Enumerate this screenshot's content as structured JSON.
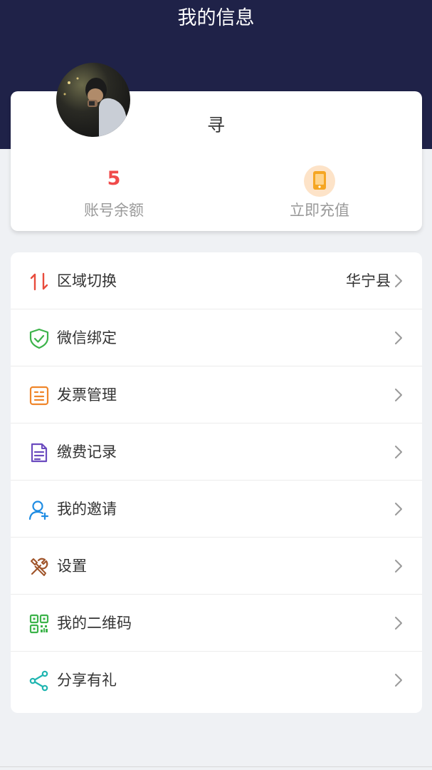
{
  "header": {
    "title": "我的信息"
  },
  "profile": {
    "username": "寻",
    "balance_value": "5",
    "balance_label": "账号余额",
    "recharge_label": "立即充值"
  },
  "menu": {
    "items": [
      {
        "label": "区域切换",
        "value": "华宁县",
        "icon": "swap-arrows-icon"
      },
      {
        "label": "微信绑定",
        "icon": "shield-check-icon"
      },
      {
        "label": "发票管理",
        "icon": "invoice-icon"
      },
      {
        "label": "缴费记录",
        "icon": "document-icon"
      },
      {
        "label": "我的邀请",
        "icon": "add-user-icon"
      },
      {
        "label": "设置",
        "icon": "tools-icon"
      },
      {
        "label": "我的二维码",
        "icon": "qr-code-icon"
      },
      {
        "label": "分享有礼",
        "icon": "share-icon"
      }
    ]
  },
  "colors": {
    "header_bg": "#1f2248",
    "balance_red": "#f04a4a",
    "recharge_orange": "#f5a623"
  }
}
